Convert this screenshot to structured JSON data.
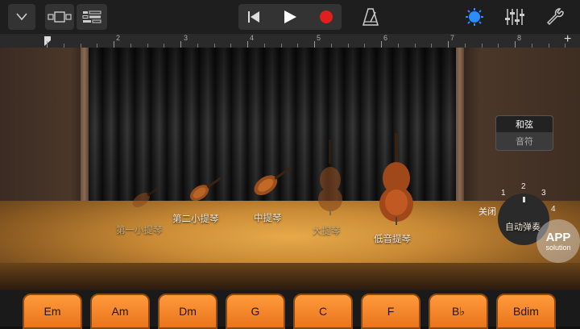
{
  "toolbar": {
    "icons": [
      "dropdown-icon",
      "tracks-view-icon",
      "mixer-icon",
      "rewind-icon",
      "play-icon",
      "record-icon",
      "metronome-icon",
      "settings-knob-icon",
      "eq-sliders-icon",
      "wrench-icon"
    ],
    "record_color": "#e0201c",
    "accent": "#2a8cff"
  },
  "ruler": {
    "marks": [
      "2",
      "3",
      "4",
      "5",
      "6",
      "7",
      "8"
    ],
    "add_label": "+"
  },
  "instruments": [
    {
      "label": "第一小提琴",
      "selected": false
    },
    {
      "label": "第二小提琴",
      "selected": true
    },
    {
      "label": "中提琴",
      "selected": true
    },
    {
      "label": "大提琴",
      "selected": false
    },
    {
      "label": "低音提琴",
      "selected": true
    }
  ],
  "mode": {
    "chords": "和弦",
    "notes": "音符"
  },
  "autoplay": {
    "off": "关闭",
    "positions": [
      "1",
      "2",
      "3",
      "4"
    ],
    "label": "自动弹奏"
  },
  "chords": [
    "Em",
    "Am",
    "Dm",
    "G",
    "C",
    "F",
    "B♭",
    "Bdim"
  ],
  "watermark": {
    "line1": "APP",
    "line2": "solution"
  }
}
